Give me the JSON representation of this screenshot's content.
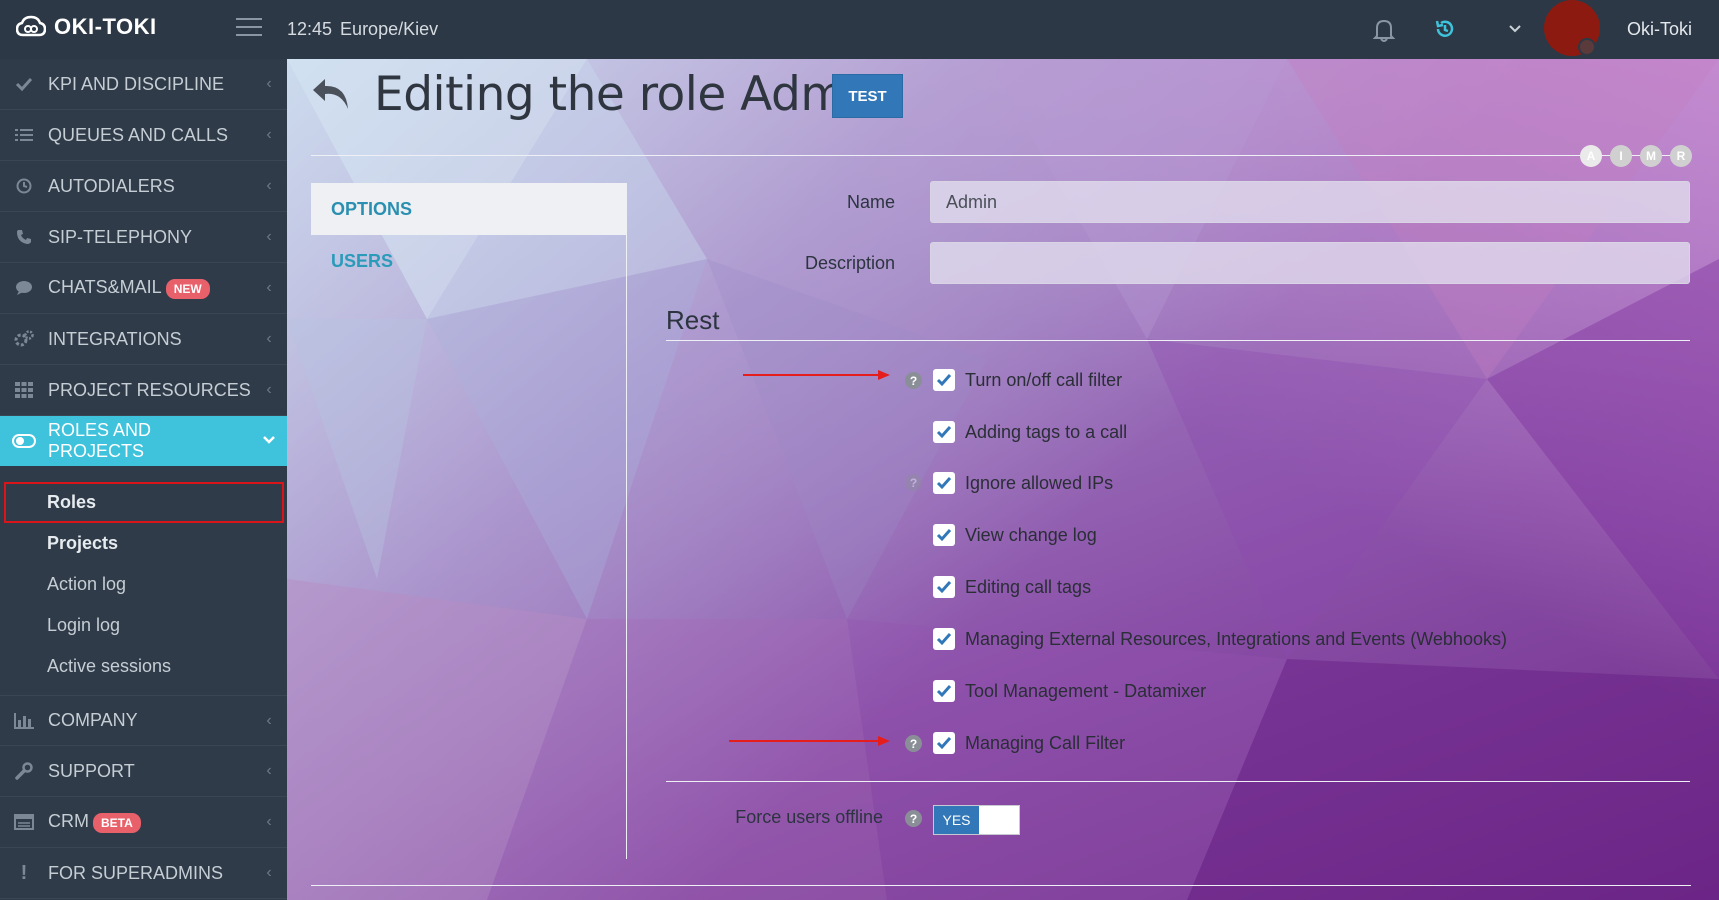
{
  "app": {
    "brand": "OKI-TOKI",
    "time": "12:45",
    "timezone": "Europe/Kiev",
    "username": "Oki-Toki"
  },
  "sidebar": {
    "items": [
      {
        "label": "KPI AND DISCIPLINE",
        "icon": "check-icon"
      },
      {
        "label": "QUEUES AND CALLS",
        "icon": "list-icon"
      },
      {
        "label": "AUTODIALERS",
        "icon": "clock-icon"
      },
      {
        "label": "SIP-TELEPHONY",
        "icon": "phone-icon"
      },
      {
        "label": "CHATS&MAIL",
        "icon": "chat-icon",
        "badge": "NEW"
      },
      {
        "label": "INTEGRATIONS",
        "icon": "gears-icon"
      },
      {
        "label": "PROJECT RESOURCES",
        "icon": "grid-icon"
      },
      {
        "label": "ROLES AND PROJECTS",
        "icon": "toggle-icon",
        "active": true
      }
    ],
    "subitems": [
      "Roles",
      "Projects",
      "Action log",
      "Login log",
      "Active sessions"
    ],
    "items_bottom": [
      {
        "label": "COMPANY",
        "icon": "bar-chart-icon"
      },
      {
        "label": "SUPPORT",
        "icon": "wrench-icon"
      },
      {
        "label": "CRM",
        "icon": "table-icon",
        "badge": "BETA"
      },
      {
        "label": "FOR SUPERADMINS",
        "icon": "exclamation-icon"
      }
    ]
  },
  "page": {
    "title": "Editing the role Admin",
    "test_button": "TEST",
    "role_markers": [
      "A",
      "I",
      "M",
      "R"
    ],
    "tabs": [
      "OPTIONS",
      "USERS"
    ],
    "form": {
      "name_label": "Name",
      "name_value": "Admin",
      "description_label": "Description",
      "description_value": ""
    },
    "section_title": "Rest",
    "permissions": [
      "Turn on/off call filter",
      "Adding tags to a call",
      "Ignore allowed IPs",
      "View change log",
      "Editing call tags",
      "Managing External Resources, Integrations and Events (Webhooks)",
      "Tool Management - Datamixer",
      "Managing Call Filter"
    ],
    "force_offline_label": "Force users offline",
    "force_offline_value": "YES"
  },
  "colors": {
    "accent": "#3fc3dc",
    "button": "#3278b8",
    "badge": "#e8606a",
    "annotation": "#e51d1d"
  }
}
